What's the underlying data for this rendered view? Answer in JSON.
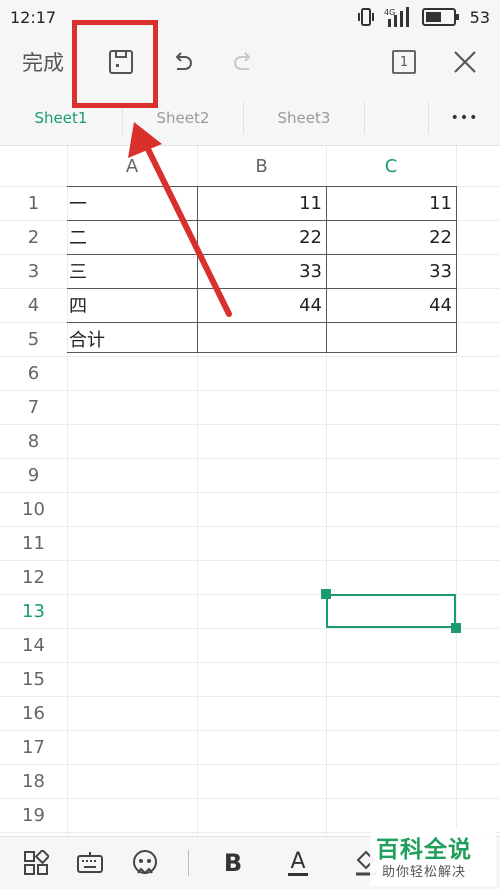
{
  "status_bar": {
    "time": "12:17",
    "network": "4G",
    "battery": "53"
  },
  "toolbar": {
    "done_label": "完成",
    "page_count": "1"
  },
  "sheet_tabs": [
    {
      "label": "Sheet1",
      "active": true
    },
    {
      "label": "Sheet2",
      "active": false
    },
    {
      "label": "Sheet3",
      "active": false
    }
  ],
  "more_label": "•••",
  "columns": [
    "A",
    "B",
    "C"
  ],
  "rows": [
    "1",
    "2",
    "3",
    "4",
    "5",
    "6",
    "7",
    "8",
    "9",
    "10",
    "11",
    "12",
    "13",
    "14",
    "15",
    "16",
    "17",
    "18",
    "19"
  ],
  "table": [
    {
      "a": "一",
      "b": "11",
      "c": "11"
    },
    {
      "a": "二",
      "b": "22",
      "c": "22"
    },
    {
      "a": "三",
      "b": "33",
      "c": "33"
    },
    {
      "a": "四",
      "b": "44",
      "c": "44"
    },
    {
      "a": "合计",
      "b": "",
      "c": ""
    }
  ],
  "selection": {
    "column": "C",
    "row": "13"
  },
  "bottom_bar": {
    "bold_label": "B",
    "font_color_label": "A"
  },
  "watermark": {
    "title": "百科全说",
    "subtitle": "助你轻松解决"
  },
  "colors": {
    "accent": "#1c9b6e",
    "annotation": "#d9302e"
  }
}
